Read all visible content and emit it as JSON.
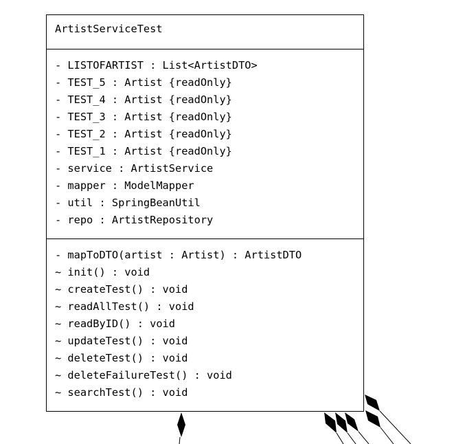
{
  "class_box": {
    "name": "ArtistServiceTest",
    "attributes": [
      "- LISTOFARTIST : List<ArtistDTO>",
      "- TEST_5 : Artist {readOnly}",
      "- TEST_4 : Artist {readOnly}",
      "- TEST_3 : Artist {readOnly}",
      "- TEST_2 : Artist {readOnly}",
      "- TEST_1 : Artist {readOnly}",
      "- service : ArtistService",
      "- mapper : ModelMapper",
      "- util : SpringBeanUtil",
      "- repo : ArtistRepository"
    ],
    "operations": [
      "- mapToDTO(artist : Artist) : ArtistDTO",
      "~ init() : void",
      "~ createTest() : void",
      "~ readAllTest() : void",
      "~ readByID() : void",
      "~ updateTest() : void",
      "~ deleteTest() : void",
      "~ deleteFailureTest() : void",
      "~ searchTest() : void"
    ]
  },
  "relationships": {
    "type": "composition",
    "count": 6
  }
}
